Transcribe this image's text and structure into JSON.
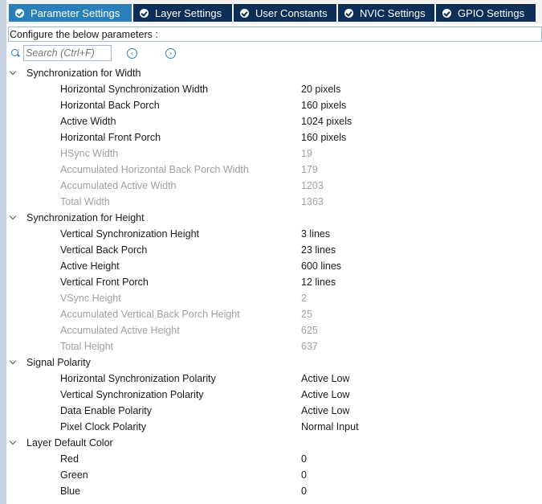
{
  "tabs": [
    {
      "label": "Parameter Settings",
      "active": true
    },
    {
      "label": "Layer Settings",
      "active": false
    },
    {
      "label": "User Constants",
      "active": false
    },
    {
      "label": "NVIC Settings",
      "active": false
    },
    {
      "label": "GPIO Settings",
      "active": false
    }
  ],
  "config_label": "Configure the below parameters :",
  "search": {
    "placeholder": "Search (Ctrl+F)"
  },
  "groups": [
    {
      "name": "Synchronization for Width",
      "rows": [
        {
          "label": "Horizontal Synchronization Width",
          "value": "20 pixels",
          "enabled": true
        },
        {
          "label": "Horizontal Back Porch",
          "value": "160 pixels",
          "enabled": true
        },
        {
          "label": "Active Width",
          "value": "1024 pixels",
          "enabled": true
        },
        {
          "label": "Horizontal Front Porch",
          "value": "160 pixels",
          "enabled": true
        },
        {
          "label": "HSync Width",
          "value": "19",
          "enabled": false
        },
        {
          "label": "Accumulated Horizontal Back Porch Width",
          "value": "179",
          "enabled": false
        },
        {
          "label": "Accumulated Active Width",
          "value": "1203",
          "enabled": false
        },
        {
          "label": "Total Width",
          "value": "1363",
          "enabled": false
        }
      ]
    },
    {
      "name": "Synchronization for Height",
      "rows": [
        {
          "label": "Vertical Synchronization Height",
          "value": "3 lines",
          "enabled": true
        },
        {
          "label": "Vertical Back Porch",
          "value": "23 lines",
          "enabled": true
        },
        {
          "label": "Active Height",
          "value": "600 lines",
          "enabled": true
        },
        {
          "label": "Vertical Front Porch",
          "value": "12 lines",
          "enabled": true
        },
        {
          "label": "VSync Height",
          "value": "2",
          "enabled": false
        },
        {
          "label": "Accumulated Vertical Back Porch Height",
          "value": "25",
          "enabled": false
        },
        {
          "label": "Accumulated Active Height",
          "value": "625",
          "enabled": false
        },
        {
          "label": "Total Height",
          "value": "637",
          "enabled": false
        }
      ]
    },
    {
      "name": "Signal Polarity",
      "rows": [
        {
          "label": "Horizontal Synchronization Polarity",
          "value": "Active Low",
          "enabled": true
        },
        {
          "label": "Vertical Synchronization Polarity",
          "value": "Active Low",
          "enabled": true
        },
        {
          "label": "Data Enable Polarity",
          "value": "Active Low",
          "enabled": true
        },
        {
          "label": "Pixel Clock Polarity",
          "value": "Normal Input",
          "enabled": true
        }
      ]
    },
    {
      "name": "Layer Default Color",
      "rows": [
        {
          "label": "Red",
          "value": "0",
          "enabled": true
        },
        {
          "label": "Green",
          "value": "0",
          "enabled": true
        },
        {
          "label": "Blue",
          "value": "0",
          "enabled": true
        }
      ]
    }
  ]
}
